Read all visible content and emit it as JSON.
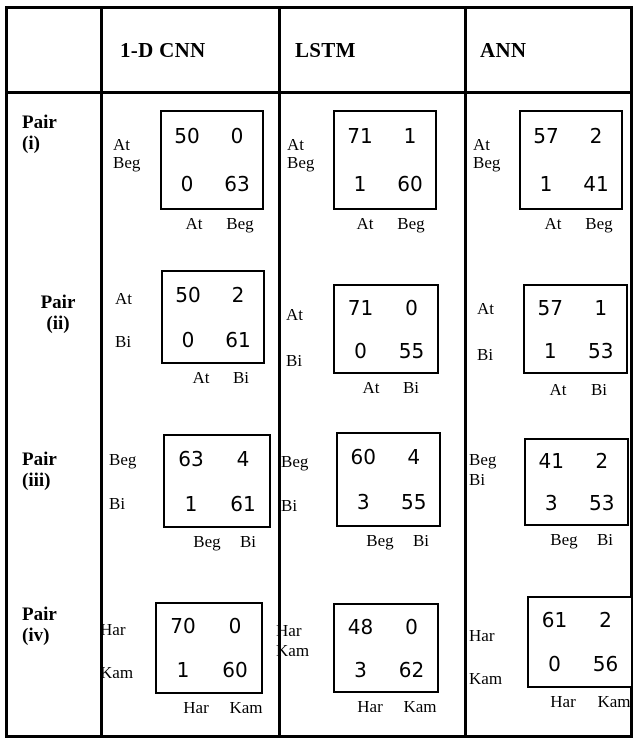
{
  "header": {
    "blank_label": "",
    "columns": [
      {
        "label": "1-D CNN"
      },
      {
        "label": "LSTM"
      },
      {
        "label": "ANN"
      }
    ]
  },
  "rows": [
    {
      "pair_word": "Pair",
      "pair_num": "(i)"
    },
    {
      "pair_word": "Pair",
      "pair_num": "(ii)"
    },
    {
      "pair_word": "Pair",
      "pair_num": "(iii)"
    },
    {
      "pair_word": "Pair",
      "pair_num": "(iv)"
    }
  ],
  "chart_data": {
    "type": "table",
    "title": "",
    "description": "Confusion matrices for four class pairs across three models",
    "model_columns": [
      "1-D CNN",
      "LSTM",
      "ANN"
    ],
    "pairs": [
      "Pair (i)",
      "Pair (ii)",
      "Pair (iii)",
      "Pair (iv)"
    ],
    "matrices": [
      {
        "pair": "Pair (i)",
        "classes": [
          "At",
          "Beg"
        ],
        "cells": [
          {
            "model": "1-D CNN",
            "row_labels": [
              "At",
              "Beg"
            ],
            "col_labels": [
              "At",
              "Beg"
            ],
            "values": [
              [
                50,
                0
              ],
              [
                0,
                63
              ]
            ]
          },
          {
            "model": "LSTM",
            "row_labels": [
              "At",
              "Beg"
            ],
            "col_labels": [
              "At",
              "Beg"
            ],
            "values": [
              [
                71,
                1
              ],
              [
                1,
                60
              ]
            ]
          },
          {
            "model": "ANN",
            "row_labels": [
              "At",
              "Beg"
            ],
            "col_labels": [
              "At",
              "Beg"
            ],
            "values": [
              [
                57,
                2
              ],
              [
                1,
                41
              ]
            ]
          }
        ]
      },
      {
        "pair": "Pair (ii)",
        "classes": [
          "At",
          "Bi"
        ],
        "cells": [
          {
            "model": "1-D CNN",
            "row_labels": [
              "At",
              "Bi"
            ],
            "col_labels": [
              "At",
              "Bi"
            ],
            "values": [
              [
                50,
                2
              ],
              [
                0,
                61
              ]
            ]
          },
          {
            "model": "LSTM",
            "row_labels": [
              "At",
              "Bi"
            ],
            "col_labels": [
              "At",
              "Bi"
            ],
            "values": [
              [
                71,
                0
              ],
              [
                0,
                55
              ]
            ]
          },
          {
            "model": "ANN",
            "row_labels": [
              "At",
              "Bi"
            ],
            "col_labels": [
              "At",
              "Bi"
            ],
            "values": [
              [
                57,
                1
              ],
              [
                1,
                53
              ]
            ]
          }
        ]
      },
      {
        "pair": "Pair (iii)",
        "classes": [
          "Beg",
          "Bi"
        ],
        "cells": [
          {
            "model": "1-D CNN",
            "row_labels": [
              "Beg",
              "Bi"
            ],
            "col_labels": [
              "Beg",
              "Bi"
            ],
            "values": [
              [
                63,
                4
              ],
              [
                1,
                61
              ]
            ]
          },
          {
            "model": "LSTM",
            "row_labels": [
              "Beg",
              "Bi"
            ],
            "col_labels": [
              "Beg",
              "Bi"
            ],
            "values": [
              [
                60,
                4
              ],
              [
                3,
                55
              ]
            ]
          },
          {
            "model": "ANN",
            "row_labels": [
              "Beg",
              "Bi"
            ],
            "col_labels": [
              "Beg",
              "Bi"
            ],
            "values": [
              [
                41,
                2
              ],
              [
                3,
                53
              ]
            ]
          }
        ]
      },
      {
        "pair": "Pair (iv)",
        "classes": [
          "Har",
          "Kam"
        ],
        "cells": [
          {
            "model": "1-D CNN",
            "row_labels": [
              "Har",
              "Kam"
            ],
            "col_labels": [
              "Har",
              "Kam"
            ],
            "values": [
              [
                70,
                0
              ],
              [
                1,
                60
              ]
            ]
          },
          {
            "model": "LSTM",
            "row_labels": [
              "Har",
              "Kam"
            ],
            "col_labels": [
              "Har",
              "Kam"
            ],
            "values": [
              [
                48,
                0
              ],
              [
                3,
                62
              ]
            ]
          },
          {
            "model": "ANN",
            "row_labels": [
              "Har",
              "Kam"
            ],
            "col_labels": [
              "Har",
              "Kam"
            ],
            "values": [
              [
                61,
                2
              ],
              [
                0,
                56
              ]
            ]
          }
        ]
      }
    ]
  },
  "colors": {
    "border": "#000000",
    "text": "#000000",
    "background": "#ffffff"
  }
}
